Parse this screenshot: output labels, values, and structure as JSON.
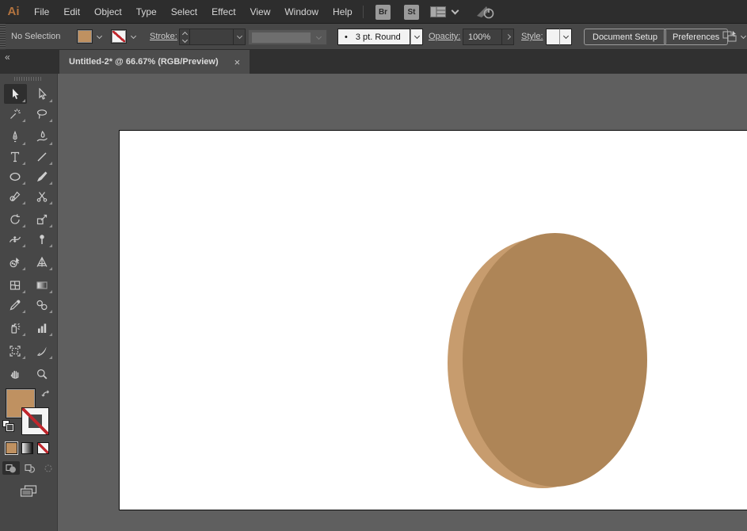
{
  "menu_bar": {
    "logo": "Ai",
    "items": [
      "File",
      "Edit",
      "Object",
      "Type",
      "Select",
      "Effect",
      "View",
      "Window",
      "Help"
    ],
    "bridge_label": "Br",
    "stock_label": "St",
    "icons": [
      "bridge-icon",
      "stock-icon",
      "workspace-grid-icon",
      "chevron-down-icon",
      "gpu-preview-power-icon"
    ]
  },
  "control_bar": {
    "selection_status": "No Selection",
    "fill_swatch": "tan",
    "stroke_swatch": "none",
    "stroke_label": "Stroke:",
    "brush_bullet": "•",
    "brush_name": "3 pt. Round",
    "opacity_label": "Opacity:",
    "opacity_value": "100%",
    "style_label": "Style:",
    "document_setup_label": "Document Setup",
    "preferences_label": "Preferences"
  },
  "tab_bar": {
    "collapse_glyph": "«",
    "tab_title": "Untitled-2* @ 66.67% (RGB/Preview)",
    "close_glyph": "×"
  },
  "toolbar": {
    "active_tool": "selection",
    "tools": [
      "selection",
      "direct-selection",
      "magic-wand",
      "lasso",
      "pen",
      "curvature",
      "type",
      "line-segment",
      "ellipse",
      "paintbrush",
      "pencil",
      "scissors",
      "rotate",
      "scale",
      "width",
      "puppet-warp",
      "shape-builder",
      "perspective-grid",
      "mesh",
      "gradient",
      "eyedropper",
      "blend",
      "symbol-sprayer",
      "column-graph",
      "artboard",
      "slice",
      "hand",
      "zoom"
    ],
    "swatch_buttons": [
      "color",
      "gradient",
      "none"
    ],
    "draw_modes": [
      "draw-normal",
      "draw-behind",
      "draw-inside"
    ]
  },
  "canvas": {
    "artboard_color": "#ffffff",
    "pasteboard_color": "#5f5f5f",
    "shapes": [
      {
        "name": "back-ellipse",
        "fill": "#C79C6E"
      },
      {
        "name": "front-ellipse",
        "fill": "#AE8557"
      }
    ]
  },
  "colors": {
    "fill_tan": "#BF9161",
    "ellipse_back": "#C79C6E",
    "ellipse_front": "#AE8557",
    "ui_dark": "#2d2d2d",
    "ui_mid": "#474747",
    "pasteboard": "#5f5f5f",
    "none_red": "#c0272d"
  }
}
